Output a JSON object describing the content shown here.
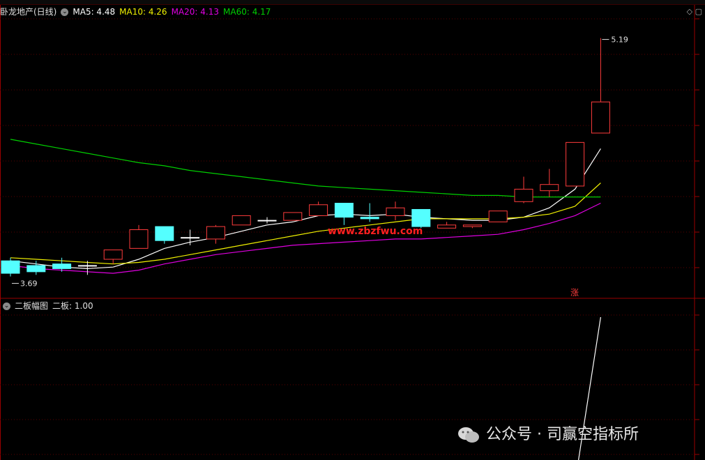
{
  "main_panel": {
    "title": "卧龙地产(日线)",
    "indicators": [
      {
        "label": "MA5: 4.48",
        "color": "#ffffff"
      },
      {
        "label": "MA10: 4.26",
        "color": "#f0f000"
      },
      {
        "label": "MA20: 4.13",
        "color": "#e000e0"
      },
      {
        "label": "MA60: 4.17",
        "color": "#00d000"
      }
    ],
    "low_marker": "3.69",
    "high_marker": "5.19",
    "zt_label": "涨",
    "center_watermark": "www.zbzfwu.com"
  },
  "indicator_panel": {
    "title": "二板幅图",
    "value_label": "二板: 1.00"
  },
  "chart_data": {
    "type": "candlestick",
    "ylim": [
      3.6,
      5.3
    ],
    "candles": [
      {
        "o": 3.76,
        "c": 3.68,
        "h": 3.78,
        "l": 3.66
      },
      {
        "o": 3.73,
        "c": 3.69,
        "h": 3.76,
        "l": 3.67
      },
      {
        "o": 3.74,
        "c": 3.71,
        "h": 3.78,
        "l": 3.69
      },
      {
        "o": 3.73,
        "c": 3.73,
        "h": 3.76,
        "l": 3.67
      },
      {
        "o": 3.77,
        "c": 3.83,
        "h": 3.83,
        "l": 3.74
      },
      {
        "o": 3.84,
        "c": 3.96,
        "h": 3.99,
        "l": 3.84
      },
      {
        "o": 3.98,
        "c": 3.89,
        "h": 3.98,
        "l": 3.87
      },
      {
        "o": 3.91,
        "c": 3.91,
        "h": 3.96,
        "l": 3.86
      },
      {
        "o": 3.9,
        "c": 3.98,
        "h": 3.99,
        "l": 3.87
      },
      {
        "o": 3.99,
        "c": 4.05,
        "h": 4.05,
        "l": 3.99
      },
      {
        "o": 4.02,
        "c": 4.02,
        "h": 4.04,
        "l": 4.0
      },
      {
        "o": 4.02,
        "c": 4.07,
        "h": 4.07,
        "l": 4.02
      },
      {
        "o": 4.05,
        "c": 4.12,
        "h": 4.14,
        "l": 4.05
      },
      {
        "o": 4.13,
        "c": 4.04,
        "h": 4.13,
        "l": 3.99
      },
      {
        "o": 4.04,
        "c": 4.03,
        "h": 4.13,
        "l": 4.01
      },
      {
        "o": 4.05,
        "c": 4.1,
        "h": 4.14,
        "l": 4.02
      },
      {
        "o": 4.09,
        "c": 3.98,
        "h": 4.09,
        "l": 3.97
      },
      {
        "o": 3.97,
        "c": 3.99,
        "h": 4.01,
        "l": 3.97
      },
      {
        "o": 3.98,
        "c": 3.99,
        "h": 3.99,
        "l": 3.97
      },
      {
        "o": 4.01,
        "c": 4.08,
        "h": 4.08,
        "l": 4.01
      },
      {
        "o": 4.14,
        "c": 4.22,
        "h": 4.3,
        "l": 4.13
      },
      {
        "o": 4.21,
        "c": 4.25,
        "h": 4.35,
        "l": 4.17
      },
      {
        "o": 4.24,
        "c": 4.52,
        "h": 4.52,
        "l": 4.24
      },
      {
        "o": 4.58,
        "c": 4.78,
        "h": 5.19,
        "l": 4.58
      }
    ],
    "ma_series": [
      {
        "name": "MA5",
        "color": "#ffffff",
        "values": [
          3.76,
          3.74,
          3.72,
          3.71,
          3.72,
          3.77,
          3.84,
          3.88,
          3.91,
          3.95,
          3.99,
          4.01,
          4.05,
          4.06,
          4.05,
          4.06,
          4.04,
          4.03,
          4.02,
          4.02,
          4.04,
          4.1,
          4.22,
          4.48
        ]
      },
      {
        "name": "MA10",
        "color": "#f0f000",
        "values": [
          3.78,
          3.77,
          3.76,
          3.75,
          3.74,
          3.75,
          3.77,
          3.8,
          3.83,
          3.86,
          3.89,
          3.92,
          3.95,
          3.97,
          3.99,
          4.01,
          4.03,
          4.03,
          4.03,
          4.03,
          4.04,
          4.06,
          4.11,
          4.26
        ]
      },
      {
        "name": "MA20",
        "color": "#e000e0",
        "values": [
          3.73,
          3.71,
          3.7,
          3.69,
          3.68,
          3.7,
          3.74,
          3.77,
          3.8,
          3.82,
          3.84,
          3.86,
          3.87,
          3.88,
          3.89,
          3.9,
          3.9,
          3.91,
          3.92,
          3.93,
          3.96,
          4.0,
          4.05,
          4.13
        ]
      },
      {
        "name": "MA60",
        "color": "#00d000",
        "values": [
          4.54,
          4.51,
          4.48,
          4.45,
          4.42,
          4.39,
          4.37,
          4.34,
          4.32,
          4.3,
          4.28,
          4.26,
          4.24,
          4.23,
          4.22,
          4.21,
          4.2,
          4.19,
          4.18,
          4.18,
          4.17,
          4.17,
          4.17,
          4.17
        ]
      }
    ],
    "indicator_series": {
      "name": "二板",
      "values_tail": [
        0.0,
        1.0
      ],
      "ylim": [
        0,
        1
      ]
    }
  },
  "watermark": {
    "text": "公众号 · 司赢空指标所"
  },
  "colors": {
    "up": "#ff3c3c",
    "down": "#54ffff",
    "grid": "#5a0000",
    "frame": "#9a0000"
  }
}
